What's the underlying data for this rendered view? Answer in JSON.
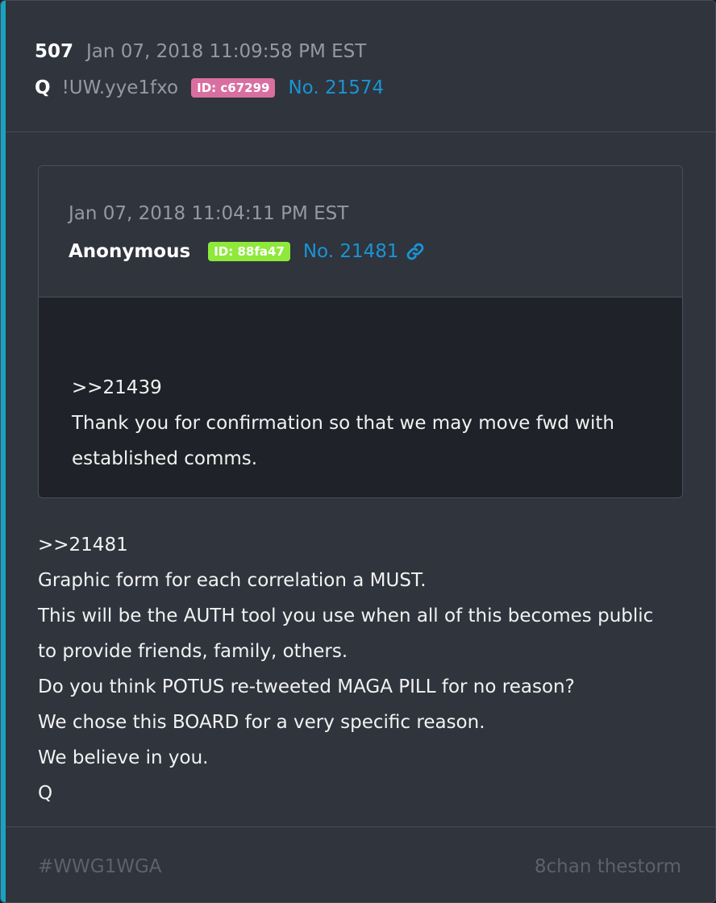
{
  "post": {
    "number": "507",
    "timestamp": "Jan 07, 2018 11:09:58 PM EST",
    "author": "Q",
    "tripcode": "!UW.yye1fxo",
    "id_badge": "ID: c67299",
    "post_link": "No. 21574"
  },
  "quoted_post": {
    "timestamp": "Jan 07, 2018 11:04:11 PM EST",
    "author": "Anonymous",
    "id_badge": "ID: 88fa47",
    "post_link": "No. 21481",
    "link_icon": "link-icon",
    "lines": [
      ">>21439",
      "Thank you for confirmation so that we may move fwd with",
      "established comms."
    ]
  },
  "body_lines": [
    ">>21481",
    "Graphic form for each correlation a MUST.",
    "This will be the AUTH tool you use when all of this becomes public",
    "to provide friends, family, others.",
    "Do you think POTUS re-tweeted MAGA PILL for no reason?",
    "We chose this BOARD for a very specific reason.",
    "We believe in you.",
    "Q"
  ],
  "footer": {
    "hashtag": "#WWG1WGA",
    "source": "8chan thestorm"
  },
  "colors": {
    "accent_bar": "#18a2c2",
    "id_badge_post": "#d96fa0",
    "id_badge_quoted": "#8ee93a",
    "link": "#1a94d4",
    "card_background": "#2f343d",
    "quote_body_background": "#1f2228"
  }
}
